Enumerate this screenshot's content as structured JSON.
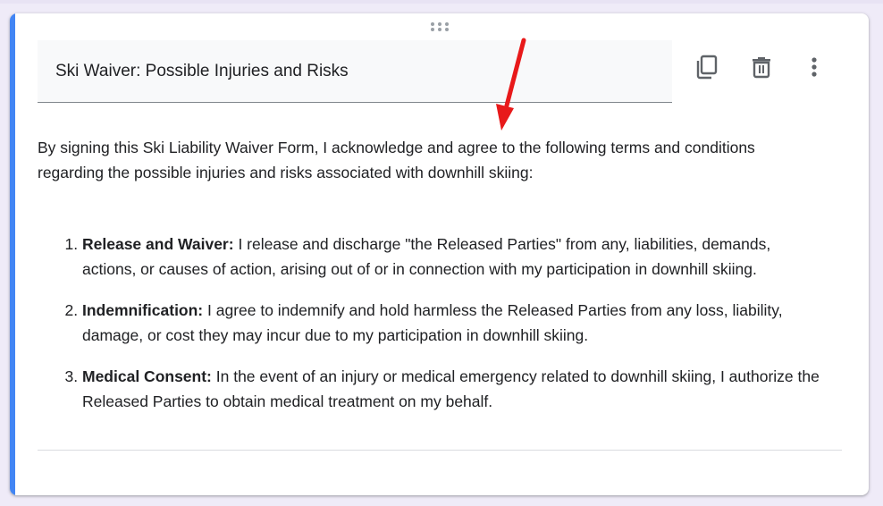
{
  "question": {
    "title": "Ski Waiver: Possible Injuries and Risks",
    "intro": "By signing this Ski Liability Waiver Form, I acknowledge and agree to the following terms and conditions regarding the possible injuries and risks associated with downhill skiing:",
    "terms": [
      {
        "heading": "Release and Waiver:",
        "text": " I release and discharge \"the Released Parties\" from any, liabilities, demands, actions, or causes of action, arising out of or in connection with my participation in downhill skiing."
      },
      {
        "heading": "Indemnification:",
        "text": " I agree to indemnify and hold harmless the Released Parties from any loss, liability, damage, or cost they may incur due to my participation in downhill skiing."
      },
      {
        "heading": "Medical Consent:",
        "text": " In the event of an injury or medical emergency related to downhill skiing, I authorize the Released Parties to obtain medical treatment on my behalf."
      }
    ]
  },
  "toolbar": {
    "copy_icon": "copy-icon",
    "delete_icon": "trash-icon",
    "more_icon": "more-vert-icon"
  },
  "colors": {
    "accent": "#4285f4",
    "arrow": "#e8191a",
    "background": "#efebf8"
  }
}
